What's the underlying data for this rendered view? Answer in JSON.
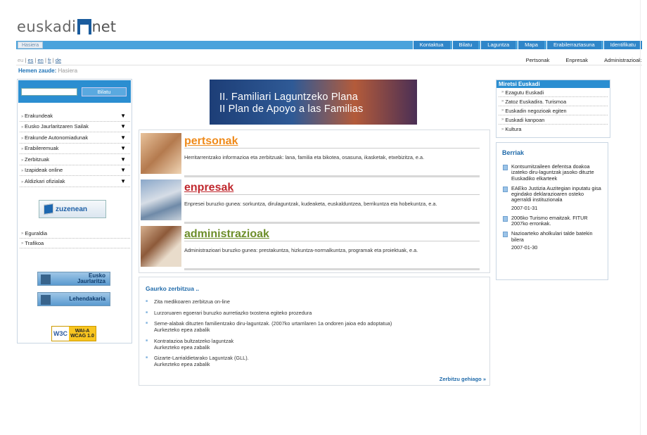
{
  "logo": {
    "part1": "euskadi",
    "part2": "net"
  },
  "topbar": {
    "home": "Hasiera",
    "menu": [
      "Kontaktua",
      "Bilatu",
      "Laguntza",
      "Mapa",
      "Erabilerraztasuna",
      "Identifikatu"
    ]
  },
  "langs": {
    "eu": "eu",
    "es": "es",
    "en": "en",
    "fr": "fr",
    "de": "de"
  },
  "audiences": [
    "Pertsonak",
    "Enpresak",
    "Administrazioak"
  ],
  "breadcrumb": {
    "label": "Hemen zaude:",
    "current": "Hasiera"
  },
  "search": {
    "placeholder": "",
    "button": "Bilatu"
  },
  "leftmenu": [
    "Erakundeak",
    "Eusko Jaurlaritzaren Sailak",
    "Erakunde Autonomiadunak",
    "Erabileremuak",
    "Zerbitzuak",
    "Izapideak online",
    "Aldizkari ofizialak"
  ],
  "zuzenean": {
    "title": "zuzenean",
    "sub": ""
  },
  "leftlinks": [
    "Eguraldia",
    "Trafikoa"
  ],
  "gov_buttons": {
    "eusko": "Eusko Jaurlaritza",
    "lehendakaria": "Lehendakaria"
  },
  "w3c": {
    "left": "W3C",
    "line1": "WAI-A",
    "line2": "WCAG 1.0"
  },
  "banner": {
    "line1": "II. Familiari Laguntzeko Plana",
    "line2": "II Plan de Apoyo a las Familias"
  },
  "sections": {
    "pertsonak": {
      "title": "pertsonak",
      "desc": "Herritarrentzako informazioa eta zerbitzuak: lana, familia eta bikotea, osasuna, ikasketak, etxebizitza, e.a."
    },
    "enpresak": {
      "title": "enpresak",
      "desc": "Enpresei buruzko gunea: sorkuntza, dirulaguntzak, kudeaketa, euskalduntzea, berrikuntza eta hobekuntza, e.a."
    },
    "administrazioak": {
      "title": "administrazioak",
      "desc": "Administrazioari buruzko gunea: prestakuntza, hizkuntza-normalkuntza, programak eta proiektuak, e.a."
    }
  },
  "services": {
    "head": "Gaurko zerbitzua ..",
    "items": [
      {
        "text": "Zita medikoaren zerbitzua on-line",
        "sub": ""
      },
      {
        "text": "Lurzoruaren egoerari buruzko aurretiazko txostena egiteko prozedura",
        "sub": ""
      },
      {
        "text": "Seme-alabak dituzten familientzako diru-laguntzak. (2007ko urtarrilaren 1a ondoren jaioa edo adoptatua)",
        "sub": "Aurkezteko epea zabalik"
      },
      {
        "text": "Kontratazioa bultzatzeko laguntzak",
        "sub": "Aurkezteko epea zabalik"
      },
      {
        "text": "Gizarte-Larrialdietarako Laguntzak (GLL).",
        "sub": "Aurkezteko epea zabalik"
      }
    ],
    "more": "Zerbitzu gehiago »"
  },
  "miretsi": {
    "head": "Miretsi Euskadi",
    "items": [
      "Ezagutu Euskadi",
      "Zatoz Euskadira. Turismoa",
      "Euskadin negozioak egiten",
      "Euskadi kanpoan",
      "Kultura"
    ]
  },
  "news": {
    "head": "Berriak",
    "items": [
      {
        "text": "Kontsumitzaileen defentsa doakoa izateko diru-laguntzak jasoko dituzte Euskadiko elkarteek",
        "date": ""
      },
      {
        "text": "EAEko Justizia Auzitegian inputatu gisa egindako deklarazioaren osteko agerraldi instituzionala",
        "date": "2007-01-31"
      },
      {
        "text": "2006ko Turismo emaitzak. FITUR 2007ko erronkak.",
        "date": ""
      },
      {
        "text": "Nazioarteko aholkulari talde batekin bilera",
        "date": "2007-01-30"
      }
    ]
  },
  "colors": {
    "accent": "#2b8ed1",
    "pertsonak": "#ef8a1a",
    "enpresak": "#c0282e",
    "administrazioak": "#6d8e2a",
    "link": "#1f6aaa"
  },
  "icons": [
    "cube-icon",
    "document-icon",
    "arrow-down-icon"
  ]
}
